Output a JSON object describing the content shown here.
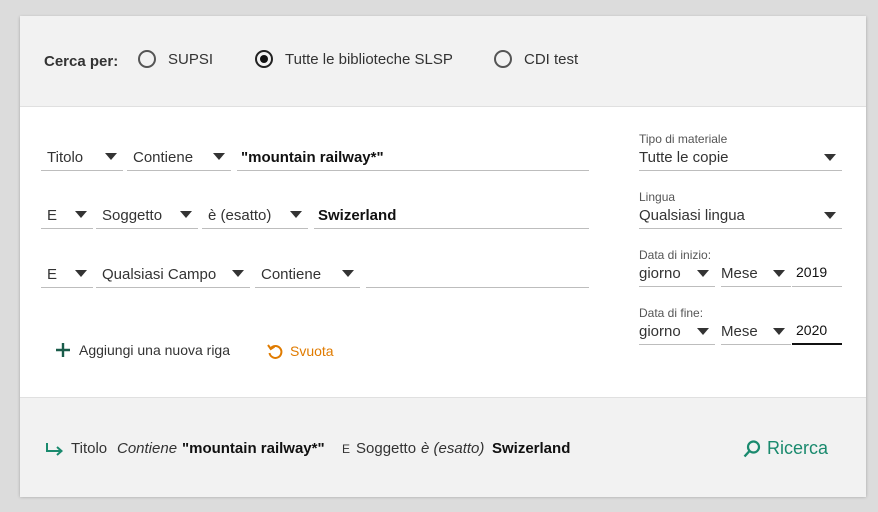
{
  "scope": {
    "label": "Cerca per:",
    "options": [
      {
        "label": "SUPSI",
        "checked": false
      },
      {
        "label": "Tutte le biblioteche SLSP",
        "checked": true
      },
      {
        "label": "CDI test",
        "checked": false
      }
    ]
  },
  "rows": [
    {
      "operator": "",
      "field": "Titolo",
      "precision": "Contiene",
      "value": "\"mountain railway*\""
    },
    {
      "operator": "E",
      "field": "Soggetto",
      "precision": "è (esatto)",
      "value": "Swizerland"
    },
    {
      "operator": "E",
      "field": "Qualsiasi Campo",
      "precision": "Contiene",
      "value": ""
    }
  ],
  "actions": {
    "add_row": "Aggiungi una nuova riga",
    "clear": "Svuota"
  },
  "filters": {
    "material_label": "Tipo di materiale",
    "material_value": "Tutte le copie",
    "language_label": "Lingua",
    "language_value": "Qualsiasi lingua",
    "start_label": "Data di inizio:",
    "start_day": "giorno",
    "start_month": "Mese",
    "start_year": "2019",
    "end_label": "Data di fine:",
    "end_day": "giorno",
    "end_month": "Mese",
    "end_year": "2020"
  },
  "summary": {
    "field1": "Titolo",
    "prec1": "Contiene",
    "val1": "\"mountain railway*\"",
    "op2": "E",
    "field2": "Soggetto",
    "prec2": "è (esatto)",
    "val2": "Swizerland",
    "search_label": "Ricerca"
  },
  "colors": {
    "accent_green": "#1a8a6e",
    "accent_orange": "#e07b00"
  }
}
